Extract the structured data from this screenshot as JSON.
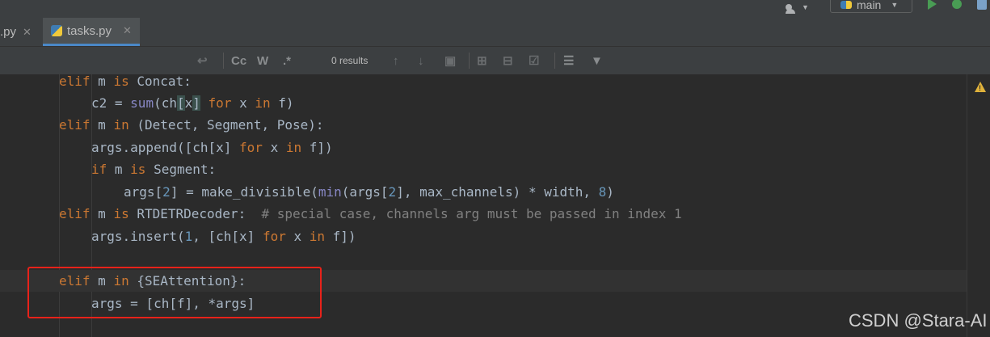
{
  "toolbar": {
    "branch": "main"
  },
  "tabs": [
    {
      "label": ".py"
    },
    {
      "label": "tasks.py"
    }
  ],
  "find": {
    "match_case": "Cc",
    "words": "W",
    "regex": ".*",
    "results": "0 results"
  },
  "code_lines": [
    "elif m is Concat:",
    "c2 = sum(ch[x] for x in f)",
    "elif m in (Detect, Segment, Pose):",
    "args.append([ch[x] for x in f])",
    "if m is Segment:",
    "args[2] = make_divisible(min(args[2], max_channels) * width, 8)",
    "elif m is RTDETRDecoder:  # special case, channels arg must be passed in index 1",
    "args.insert(1, [ch[x] for x in f])",
    "",
    "elif m in {SEAttention}:",
    "args = [ch[f], *args]"
  ],
  "watermark": "CSDN @Stara-AI",
  "colors": {
    "keyword": "#cc7832",
    "builtin": "#8888c6",
    "number": "#6897bb",
    "comment": "#808080",
    "highlight_box": "#e8221a"
  }
}
